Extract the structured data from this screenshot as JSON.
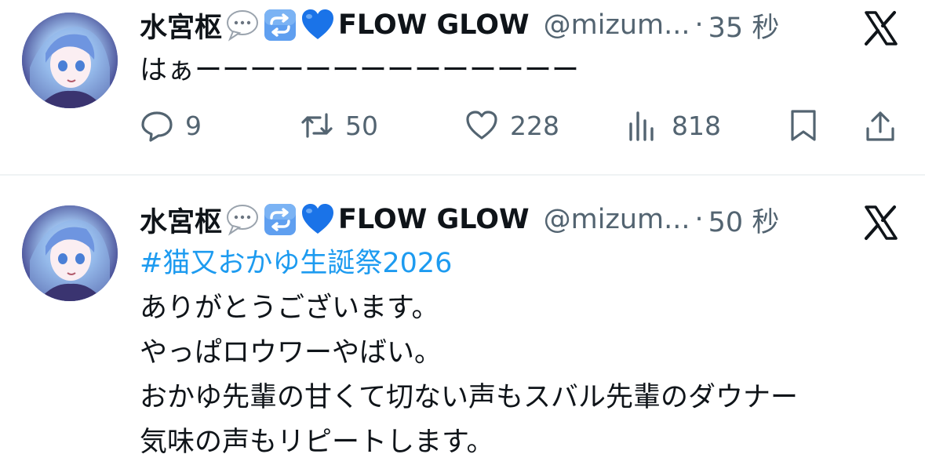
{
  "tweets": [
    {
      "display_name": "水宮枢",
      "brand": "FLOW GLOW",
      "handle": "@mizum...",
      "separator": "·",
      "time": "35 秒",
      "text": "はぁーーーーーーーーーーーーーー",
      "replies": "9",
      "reposts": "50",
      "likes": "228",
      "views": "818"
    },
    {
      "display_name": "水宮枢",
      "brand": "FLOW GLOW",
      "handle": "@mizum...",
      "separator": "·",
      "time": "50 秒",
      "hashtag": "#猫又おかゆ生誕祭2026",
      "lines": [
        "ありがとうございます。",
        "やっぱロウワーやばい。",
        "おかゆ先輩の甘くて切ない声もスバル先輩のダウナー",
        "気味の声もリピートします。"
      ]
    }
  ],
  "icons": {
    "name_emojis": [
      "speech-bubble-icon",
      "repeat-icon",
      "blue-heart-icon"
    ],
    "actions": [
      "reply-icon",
      "repost-icon",
      "like-icon",
      "views-icon",
      "bookmark-icon",
      "share-icon"
    ],
    "menu": "x-logo-icon"
  },
  "colors": {
    "text": "#0f1419",
    "secondary": "#536471",
    "link": "#1d9bf0",
    "blue_heart": "#1a73e8"
  }
}
